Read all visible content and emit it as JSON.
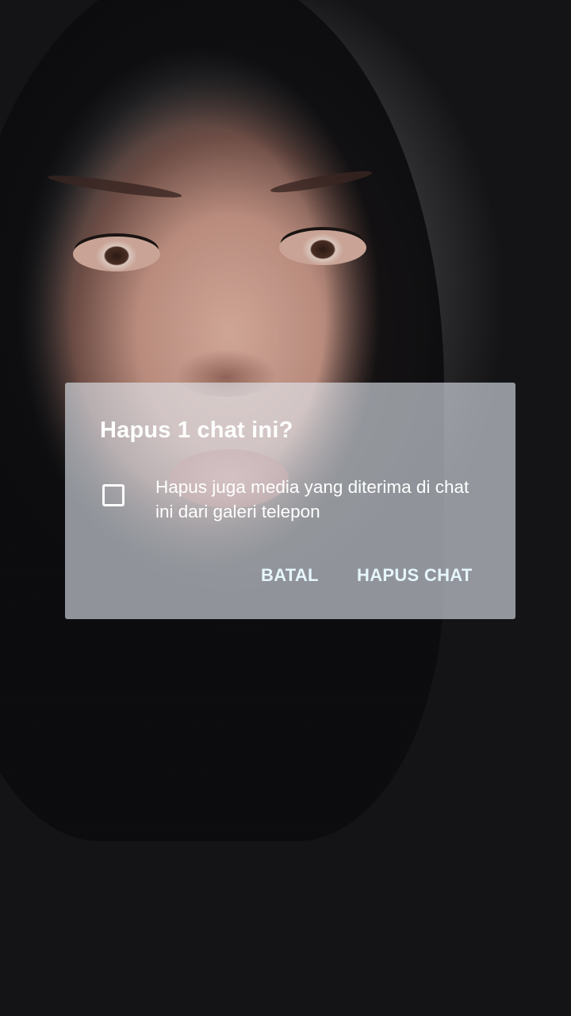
{
  "dialog": {
    "title": "Hapus 1 chat ini?",
    "checkbox_label": "Hapus juga media yang diterima di chat ini dari galeri telepon",
    "checkbox_checked": false,
    "cancel_label": "BATAL",
    "confirm_label": "HAPUS CHAT",
    "accent_color": "#e6f6fd"
  },
  "background": {
    "description_icon": "photo-background"
  }
}
